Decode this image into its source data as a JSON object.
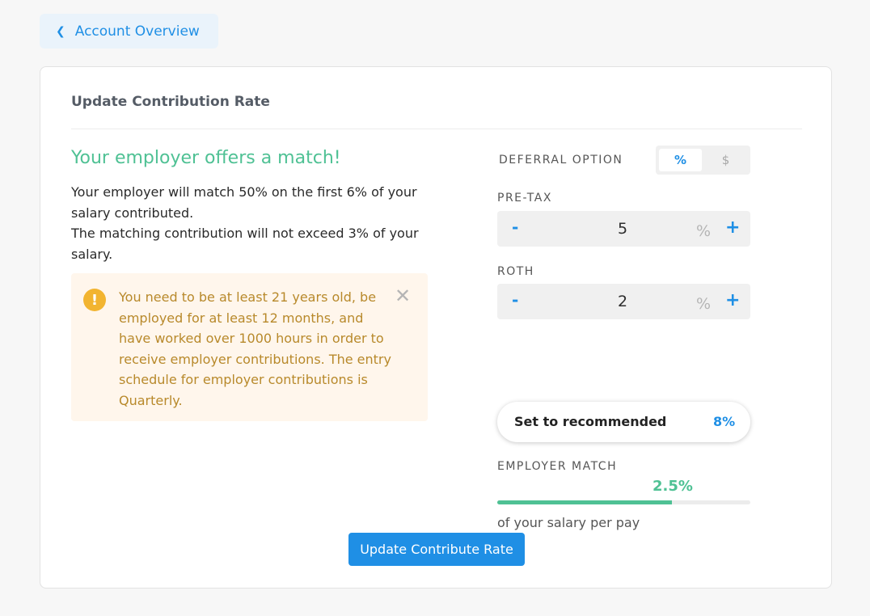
{
  "nav": {
    "back_label": "Account Overview"
  },
  "card": {
    "title": "Update Contribution Rate",
    "match_heading": "Your employer offers a match!",
    "match_desc_1": "Your employer will match 50% on the first 6% of your salary contributed.",
    "match_desc_2": "The matching contribution will not exceed 3% of your salary.",
    "alert": {
      "icon": "!",
      "text": "You need to be at least 21 years old, be employed for at least 12 months, and have worked over 1000 hours in order to receive employer contributions. The entry schedule for employer contributions is Quarterly.",
      "close": "✕"
    }
  },
  "deferral": {
    "label": "DEFERRAL OPTION",
    "options": [
      "%",
      "$"
    ],
    "selected": "%"
  },
  "pretax": {
    "label": "PRE-TAX",
    "minus": "-",
    "value": "5",
    "unit": "%",
    "plus": "+"
  },
  "roth": {
    "label": "ROTH",
    "minus": "-",
    "value": "2",
    "unit": "%",
    "plus": "+"
  },
  "recommended": {
    "label": "Set to recommended",
    "value": "8%"
  },
  "employer_match": {
    "label": "EMPLOYER MATCH",
    "value": "2.5%",
    "progress_fraction": 0.69,
    "subtext": "of your salary per pay"
  },
  "submit_label": "Update Contribute Rate",
  "colors": {
    "accent": "#1f8fe5",
    "match_green": "#4fc194",
    "alert_bg": "#fff6ec",
    "alert_text": "#b8892b",
    "alert_icon": "#f2b430"
  }
}
